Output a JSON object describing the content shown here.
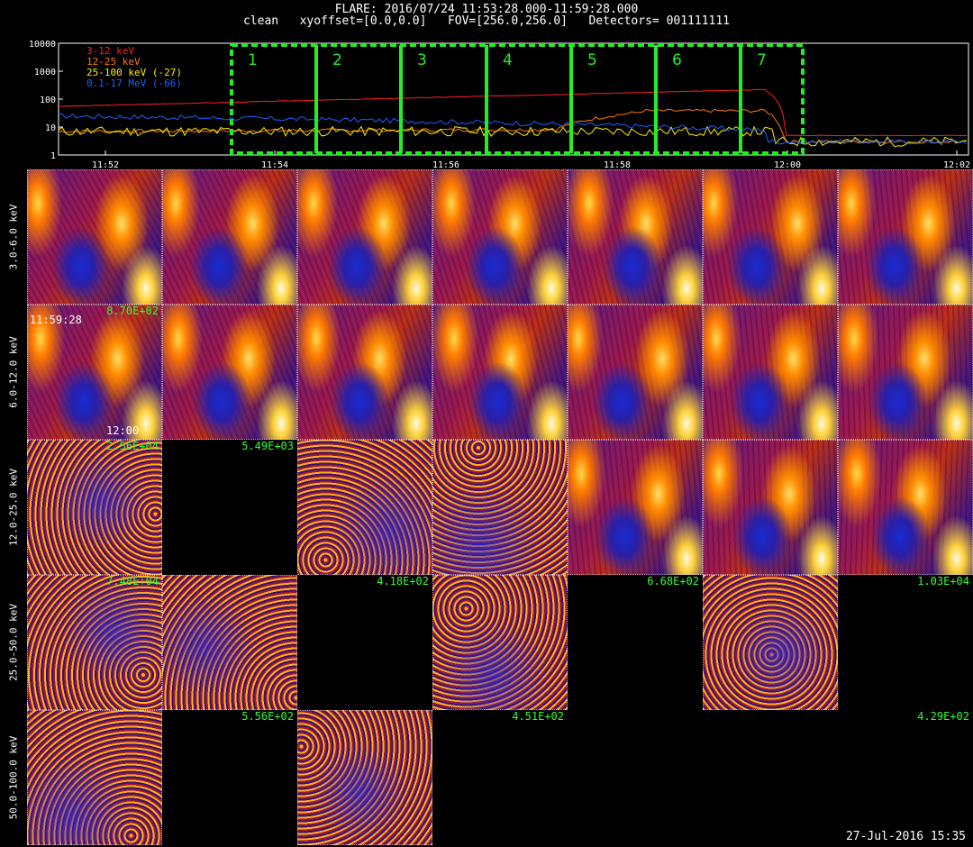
{
  "header": {
    "line1": "FLARE: 2016/07/24 11:53:28.000-11:59:28.000",
    "line2": "clean   xyoffset=[0.0,0.0]   FOV=[256.0,256.0]   Detectors= 001111111"
  },
  "lightcurve": {
    "y_ticks": [
      "10000",
      "1000",
      "100",
      "10",
      "1"
    ],
    "x_ticks": [
      "11:52",
      "11:54",
      "11:56",
      "11:58",
      "12:00",
      "12:02"
    ],
    "legend": [
      {
        "label": "3-12 keV",
        "color": "#ff2020"
      },
      {
        "label": "12-25 keV",
        "color": "#ff7a00"
      },
      {
        "label": "25-100 keV (-27)",
        "color": "#ffee00"
      },
      {
        "label": "0.1-17 MeV (-66)",
        "color": "#2060ff"
      }
    ],
    "intervals": [
      "1",
      "2",
      "3",
      "4",
      "5",
      "6",
      "7"
    ],
    "interval_color": "#22ee22"
  },
  "rows": [
    {
      "label": "3.0-6.0 keV"
    },
    {
      "label": "6.0-12.0 keV"
    },
    {
      "label": "12.0-25.0 keV"
    },
    {
      "label": "25.0-50.0 keV"
    },
    {
      "label": "50.0-100.0 keV"
    }
  ],
  "cells": [
    [
      "",
      "",
      "",
      "",
      "",
      "",
      ""
    ],
    [
      "8.70E+02",
      "",
      "",
      "",
      "",
      "",
      ""
    ],
    [
      "2.56E+04",
      "5.49E+03",
      "",
      "",
      "",
      "",
      ""
    ],
    [
      "7.48E+04",
      "",
      "4.18E+02",
      "",
      "6.68E+02",
      "",
      "1.03E+04"
    ],
    [
      "",
      "5.56E+02",
      "",
      "4.51E+02",
      "",
      "",
      "4.29E+02"
    ]
  ],
  "time_labels": {
    "start": "11:59:28",
    "end": "12:00"
  },
  "footer": "27-Jul-2016 15:35"
}
